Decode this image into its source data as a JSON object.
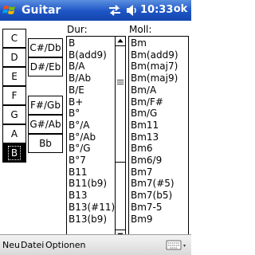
{
  "title_bar": {
    "app_title": "Guitar",
    "clock": "10:33",
    "ok_label": "ok",
    "start_icon": "windows-flag-icon",
    "sync_icon": "sync-arrows-icon",
    "volume_icon": "speaker-icon"
  },
  "notes": {
    "natural": [
      "C",
      "D",
      "E",
      "F",
      "G",
      "A",
      "B"
    ],
    "sharp": [
      "C#/Db",
      "D#/Eb",
      "F#/Gb",
      "G#/Ab",
      "Bb"
    ],
    "selected": "B"
  },
  "dur": {
    "label": "Dur:",
    "items": [
      "B",
      "B(add9)",
      "B/A",
      "B/Ab",
      "B/E",
      "B+",
      "B°",
      "B°/A",
      "B°/Ab",
      "B°/G",
      "B°7",
      "B11",
      "B11(b9)",
      "B13",
      "B13(#11)",
      "B13(b9)"
    ]
  },
  "moll": {
    "label": "Moll:",
    "items": [
      "Bm",
      "Bm(add9)",
      "Bm(maj7)",
      "Bm(maj9)",
      "Bm/A",
      "Bm/F#",
      "Bm/G",
      "Bm11",
      "Bm13",
      "Bm6",
      "Bm6/9",
      "Bm7",
      "Bm7(#5)",
      "Bm7(b5)",
      "Bm7-5",
      "Bm9"
    ]
  },
  "menu_bar": {
    "items": [
      "Neu",
      "Datei",
      "Optionen"
    ],
    "keyboard_icon": "keyboard-icon"
  },
  "colors": {
    "title_bar": "#1d55c4",
    "selected_note": "#000000",
    "menu_bar": "#d9d9d9"
  }
}
